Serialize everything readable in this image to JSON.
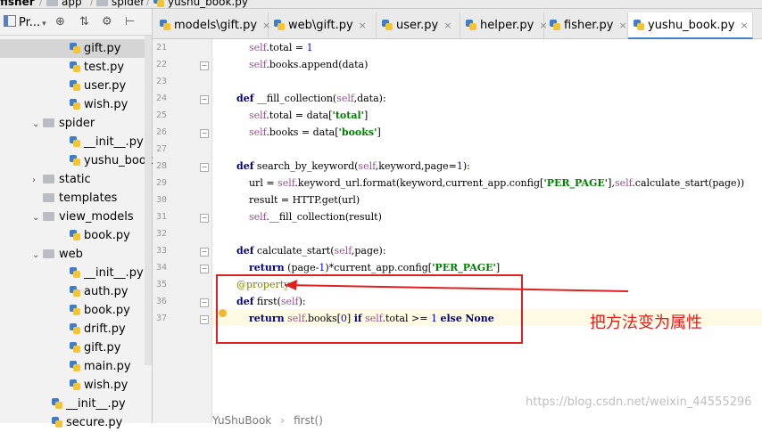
{
  "nav_bar": {
    "items": [
      "fisher",
      "app",
      "spider",
      "yushu_book.py"
    ]
  },
  "project_panel": {
    "title": "Pr...",
    "tree": [
      {
        "label": "gift.py",
        "type": "py",
        "indent": 2,
        "selected": true
      },
      {
        "label": "test.py",
        "type": "py",
        "indent": 2
      },
      {
        "label": "user.py",
        "type": "py",
        "indent": 2
      },
      {
        "label": "wish.py",
        "type": "py",
        "indent": 2
      },
      {
        "label": "spider",
        "type": "folder",
        "indent": 1,
        "expanded": true
      },
      {
        "label": "__init__.py",
        "type": "py",
        "indent": 2
      },
      {
        "label": "yushu_book.p",
        "type": "py",
        "indent": 2
      },
      {
        "label": "static",
        "type": "folder",
        "indent": 1,
        "expanded": false
      },
      {
        "label": "templates",
        "type": "folder",
        "indent": 1,
        "expanded": null
      },
      {
        "label": "view_models",
        "type": "folder",
        "indent": 1,
        "expanded": true
      },
      {
        "label": "book.py",
        "type": "py",
        "indent": 2
      },
      {
        "label": "web",
        "type": "folder",
        "indent": 1,
        "expanded": true
      },
      {
        "label": "__init__.py",
        "type": "py",
        "indent": 2
      },
      {
        "label": "auth.py",
        "type": "py",
        "indent": 2
      },
      {
        "label": "book.py",
        "type": "py",
        "indent": 2
      },
      {
        "label": "drift.py",
        "type": "py",
        "indent": 2
      },
      {
        "label": "gift.py",
        "type": "py",
        "indent": 2
      },
      {
        "label": "main.py",
        "type": "py",
        "indent": 2
      },
      {
        "label": "wish.py",
        "type": "py",
        "indent": 2
      },
      {
        "label": "__init__.py",
        "type": "py",
        "indent": 1
      },
      {
        "label": "secure.py",
        "type": "py",
        "indent": 1
      }
    ]
  },
  "tabs": [
    {
      "label": "models\\gift.py",
      "active": false
    },
    {
      "label": "web\\gift.py",
      "active": false
    },
    {
      "label": "user.py",
      "active": false
    },
    {
      "label": "helper.py",
      "active": false
    },
    {
      "label": "fisher.py",
      "active": false
    },
    {
      "label": "yushu_book.py",
      "active": true
    }
  ],
  "editor": {
    "lines": [
      {
        "num": "21",
        "code": "        self.total = 1"
      },
      {
        "num": "22",
        "code": "        self.books.append(data)"
      },
      {
        "num": "23",
        "code": ""
      },
      {
        "num": "24",
        "code": "    def __fill_collection(self,data):"
      },
      {
        "num": "25",
        "code": "        self.total = data['total']"
      },
      {
        "num": "26",
        "code": "        self.books = data['books']"
      },
      {
        "num": "27",
        "code": ""
      },
      {
        "num": "28",
        "code": "    def search_by_keyword(self,keyword,page=1):"
      },
      {
        "num": "29",
        "code": "        url = self.keyword_url.format(keyword,current_app.config['PER_PAGE'],self.calculate_start(page))"
      },
      {
        "num": "30",
        "code": "        result = HTTP.get(url)"
      },
      {
        "num": "31",
        "code": "        self.__fill_collection(result)"
      },
      {
        "num": "32",
        "code": ""
      },
      {
        "num": "33",
        "code": "    def calculate_start(self,page):"
      },
      {
        "num": "34",
        "code": "        return (page-1)*current_app.config['PER_PAGE']"
      },
      {
        "num": "35",
        "code": "    @property"
      },
      {
        "num": "36",
        "code": "    def first(self):"
      },
      {
        "num": "37",
        "code": "        return self.books[0] if self.total >= 1 else None"
      }
    ],
    "annotation": "把方法变为属性",
    "watermark": "https://blog.csdn.net/weixin_44555296",
    "bottom_breadcrumb": [
      "YuShuBook",
      "first()"
    ],
    "colors": {
      "annotation": "#e02020",
      "keyword": "#000080",
      "self": "#94558d",
      "string": "#008000"
    }
  }
}
